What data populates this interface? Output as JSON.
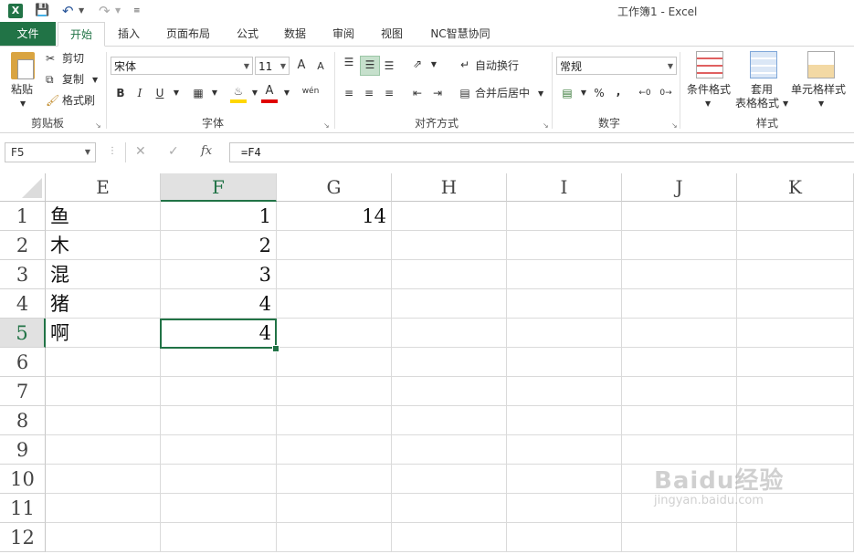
{
  "window": {
    "title": "工作簿1 - Excel"
  },
  "tabs": [
    "文件",
    "开始",
    "插入",
    "页面布局",
    "公式",
    "数据",
    "审阅",
    "视图",
    "NC智慧协同"
  ],
  "ribbon": {
    "clipboard": {
      "paste": "粘贴",
      "cut": "剪切",
      "copy": "复制",
      "format_painter": "格式刷",
      "label": "剪贴板"
    },
    "font": {
      "name": "宋体",
      "size": "11",
      "bold": "B",
      "italic": "I",
      "underline": "U",
      "grow": "A",
      "shrink": "A",
      "color_letter": "A",
      "phonetic": "wén",
      "label": "字体"
    },
    "alignment": {
      "wrap": "自动换行",
      "merge": "合并后居中",
      "label": "对齐方式"
    },
    "number": {
      "format": "常规",
      "percent": "%",
      "comma": ",",
      "label": "数字"
    },
    "styles": {
      "conditional": "条件格式",
      "table_line1": "套用",
      "table_line2": "表格格式",
      "cell_styles": "单元格样式",
      "label": "样式"
    }
  },
  "formula_bar": {
    "name_box": "F5",
    "fx": "fx",
    "formula": "=F4"
  },
  "columns": [
    "E",
    "F",
    "G",
    "H",
    "I",
    "J",
    "K"
  ],
  "rows": [
    "1",
    "2",
    "3",
    "4",
    "5",
    "6",
    "7",
    "8",
    "9",
    "10",
    "11",
    "12"
  ],
  "cells": {
    "E1": "鱼",
    "F1": "1",
    "G1": "14",
    "E2": "木",
    "F2": "2",
    "E3": "混",
    "F3": "3",
    "E4": "猪",
    "F4": "4",
    "E5": "啊",
    "F5": "4"
  },
  "selected": {
    "cell": "F5",
    "column": "F",
    "row": "5"
  },
  "watermark": {
    "brand": "Baidu经验",
    "url": "jingyan.baidu.com"
  },
  "colors": {
    "accent": "#217346"
  }
}
